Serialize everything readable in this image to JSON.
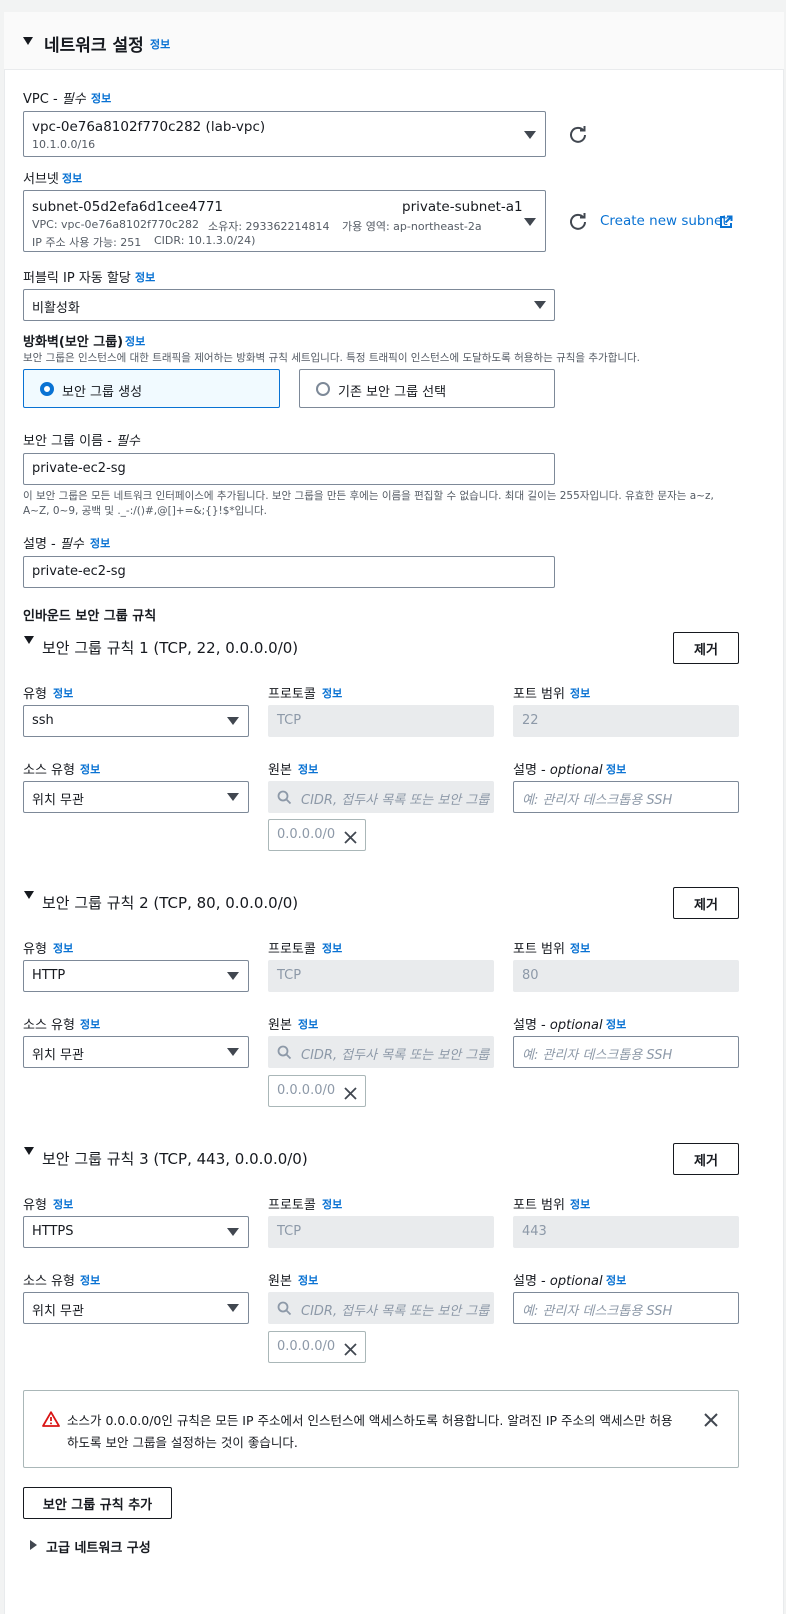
{
  "section": {
    "title": "네트워크 설정",
    "info": "정보"
  },
  "vpc": {
    "label": "VPC - ",
    "required": "필수",
    "info": "정보",
    "value": "vpc-0e76a8102f770c282 (lab-vpc)",
    "cidr": "10.1.0.0/16"
  },
  "subnet": {
    "label": "서브넷",
    "info": "정보",
    "id": "subnet-05d2efa6d1cee4771",
    "name": "private-subnet-a1",
    "vpc": "VPC: vpc-0e76a8102f770c282",
    "owner": "소유자: 293362214814",
    "az": "가용 영역: ap-northeast-2a",
    "ips": "IP 주소 사용 가능: 251",
    "cidr": "CIDR: 10.1.3.0/24)",
    "create_link": "Create new subnet"
  },
  "public_ip": {
    "label": "퍼블릭 IP 자동 할당",
    "info": "정보",
    "value": "비활성화"
  },
  "firewall": {
    "label": "방화벽(보안 그룹)",
    "info": "정보",
    "description": "보안 그룹은 인스턴스에 대한 트래픽을 제어하는 방화벽 규칙 세트입니다. 특정 트래픽이 인스턴스에 도달하도록 허용하는 규칙을 추가합니다.",
    "option_create": "보안 그룹 생성",
    "option_existing": "기존 보안 그룹 선택"
  },
  "sg_name": {
    "label": "보안 그룹 이름 - ",
    "required": "필수",
    "value": "private-ec2-sg",
    "help1": "이 보안 그룹은 모든 네트워크 인터페이스에 추가됩니다. 보안 그룹을 만든 후에는 이름을 편집할 수 없습니다. 최대 길이는 255자입니다. 유효한 문자는 a~z,",
    "help2": "A~Z, 0~9, 공백 및 ._-:/()#,@[]+=&;{}!$*입니다."
  },
  "sg_desc": {
    "label": "설명 - ",
    "required": "필수",
    "info": "정보",
    "value": "private-ec2-sg"
  },
  "inbound": {
    "title": "인바운드 보안 그룹 규칙",
    "labels": {
      "type": "유형",
      "protocol": "프로토콜",
      "port": "포트 범위",
      "source_type": "소스 유형",
      "source": "원본",
      "desc": "설명 - ",
      "optional": "optional",
      "info": "정보",
      "remove": "제거"
    },
    "rules": [
      {
        "title": "보안 그룹 규칙 1 (TCP, 22, 0.0.0.0/0)",
        "type": "ssh",
        "protocol": "TCP",
        "port": "22",
        "source_type": "위치 무관",
        "source_placeholder": "CIDR, 접두사 목록 또는 보안 그룹",
        "desc_placeholder": "예: 관리자 데스크톱용 SSH",
        "token": "0.0.0.0/0"
      },
      {
        "title": "보안 그룹 규칙 2 (TCP, 80, 0.0.0.0/0)",
        "type": "HTTP",
        "protocol": "TCP",
        "port": "80",
        "source_type": "위치 무관",
        "source_placeholder": "CIDR, 접두사 목록 또는 보안 그룹",
        "desc_placeholder": "예: 관리자 데스크톱용 SSH",
        "token": "0.0.0.0/0"
      },
      {
        "title": "보안 그룹 규칙 3 (TCP, 443, 0.0.0.0/0)",
        "type": "HTTPS",
        "protocol": "TCP",
        "port": "443",
        "source_type": "위치 무관",
        "source_placeholder": "CIDR, 접두사 목록 또는 보안 그룹",
        "desc_placeholder": "예: 관리자 데스크톱용 SSH",
        "token": "0.0.0.0/0"
      }
    ]
  },
  "warning": {
    "line1": "소스가 0.0.0.0/0인 규칙은 모든 IP 주소에서 인스턴스에 액세스하도록 허용합니다. 알려진 IP 주소의 액세스만 허용",
    "line2": "하도록 보안 그룹을 설정하는 것이 좋습니다."
  },
  "add_rule_button": "보안 그룹 규칙 추가",
  "advanced": "고급 네트워크 구성",
  "colors": {
    "link": "#0972d3",
    "selected_bg": "#f1faff",
    "warning": "#d91515",
    "border": "#7d8998"
  }
}
